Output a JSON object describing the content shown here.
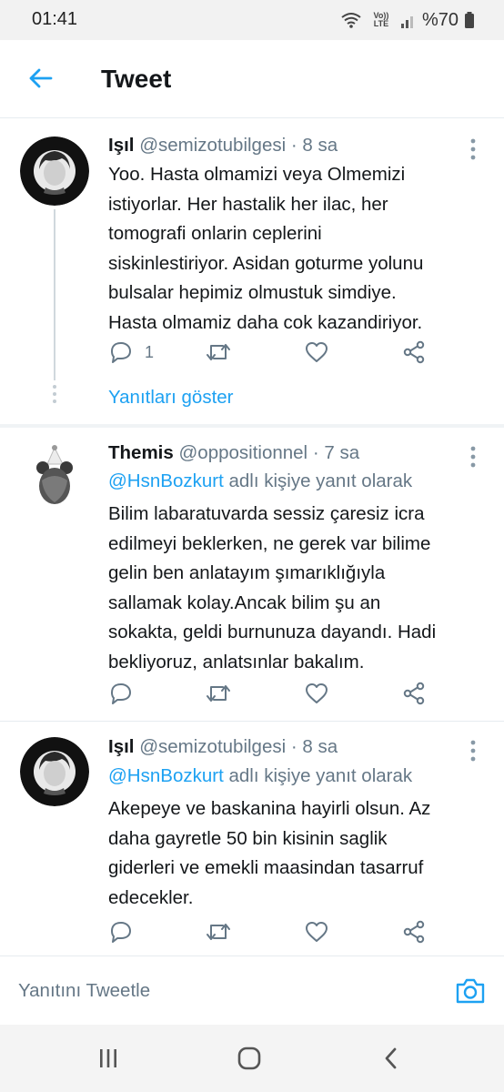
{
  "status_bar": {
    "time": "01:41",
    "network_label": "Vo)) LTE",
    "battery": "%70"
  },
  "header": {
    "title": "Tweet"
  },
  "tweets": [
    {
      "name": "Işıl",
      "handle": "@semizotubilgesi",
      "time": "· 8 sa",
      "lines": [
        "Yoo. Hasta olmamizi veya Olmemizi",
        "istiyorlar. Her hastalik her ilac, her",
        "tomografi onlarin ceplerini",
        "siskinlestiriyor. Asidan goturme yolunu",
        "bulsalar hepimiz olmustuk simdiye.",
        "Hasta olmamiz daha cok kazandiriyor."
      ],
      "reply_count": "1",
      "show_replies": "Yanıtları göster"
    },
    {
      "name": "Themis",
      "handle": "@oppositionnel",
      "time": "· 7 sa",
      "reply_to_handle": "@HsnBozkurt",
      "reply_to_suffix": " adlı kişiye yanıt olarak",
      "lines": [
        "Bilim labaratuvarda sessiz çaresiz icra",
        "edilmeyi beklerken, ne gerek var bilime",
        "gelin ben anlatayım şımarıklığıyla",
        "sallamak kolay.Ancak bilim şu an",
        "sokakta, geldi burnunuza dayandı. Hadi",
        "bekliyoruz, anlatsınlar bakalım."
      ]
    },
    {
      "name": "Işıl",
      "handle": "@semizotubilgesi",
      "time": "· 8 sa",
      "reply_to_handle": "@HsnBozkurt",
      "reply_to_suffix": " adlı kişiye yanıt olarak",
      "lines": [
        "Akepeye ve baskanina hayirli olsun. Az",
        "daha gayretle 50 bin kisinin saglik",
        "giderleri ve emekli maasindan tasarruf",
        "edecekler."
      ]
    }
  ],
  "reply_bar": {
    "placeholder": "Yanıtını Tweetle"
  },
  "colors": {
    "accent": "#1da1f2",
    "secondary_text": "#657786",
    "primary_text": "#14171a"
  },
  "icons": [
    "back-arrow-icon",
    "reply-icon",
    "retweet-icon",
    "like-icon",
    "share-icon",
    "more-icon",
    "camera-icon",
    "recent-apps-icon",
    "home-icon",
    "back-nav-icon"
  ]
}
